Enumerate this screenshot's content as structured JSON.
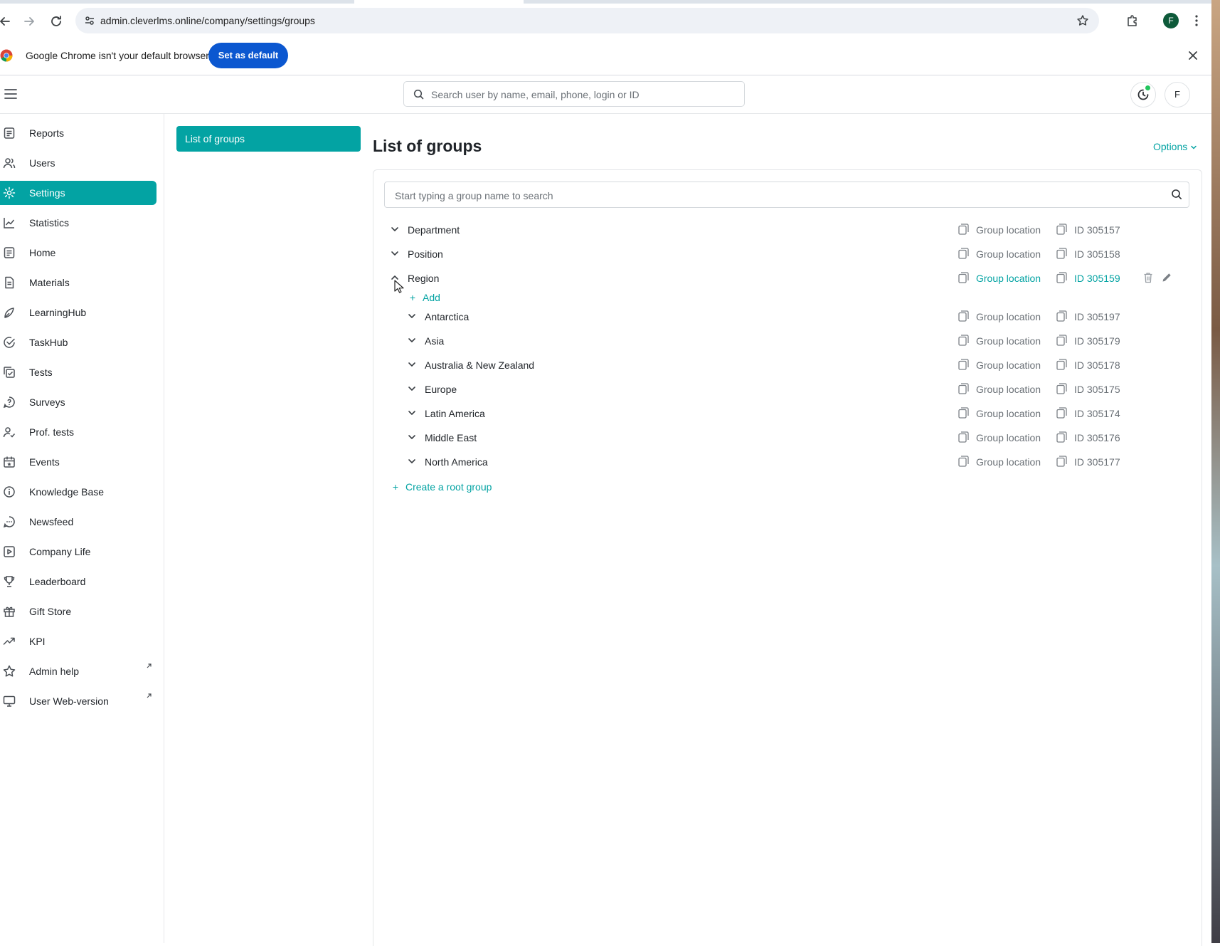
{
  "browser": {
    "url": "admin.cleverlms.online/company/settings/groups",
    "profile_initial": "F",
    "infobar_text": "Google Chrome isn't your default browser",
    "infobar_button": "Set as default"
  },
  "header": {
    "search_placeholder": "Search user by name, email, phone, login or ID",
    "avatar_initial": "F"
  },
  "sidebar": {
    "items": [
      {
        "label": "Reports",
        "icon": "reports-icon",
        "active": false
      },
      {
        "label": "Users",
        "icon": "users-icon",
        "active": false
      },
      {
        "label": "Settings",
        "icon": "settings-icon",
        "active": true
      },
      {
        "label": "Statistics",
        "icon": "statistics-icon",
        "active": false
      },
      {
        "label": "Home",
        "icon": "home-icon",
        "active": false
      },
      {
        "label": "Materials",
        "icon": "materials-icon",
        "active": false
      },
      {
        "label": "LearningHub",
        "icon": "learninghub-icon",
        "active": false
      },
      {
        "label": "TaskHub",
        "icon": "taskhub-icon",
        "active": false
      },
      {
        "label": "Tests",
        "icon": "tests-icon",
        "active": false
      },
      {
        "label": "Surveys",
        "icon": "surveys-icon",
        "active": false
      },
      {
        "label": "Prof. tests",
        "icon": "prof-tests-icon",
        "active": false
      },
      {
        "label": "Events",
        "icon": "events-icon",
        "active": false
      },
      {
        "label": "Knowledge Base",
        "icon": "knowledge-base-icon",
        "active": false
      },
      {
        "label": "Newsfeed",
        "icon": "newsfeed-icon",
        "active": false
      },
      {
        "label": "Company Life",
        "icon": "company-life-icon",
        "active": false
      },
      {
        "label": "Leaderboard",
        "icon": "leaderboard-icon",
        "active": false
      },
      {
        "label": "Gift Store",
        "icon": "gift-store-icon",
        "active": false
      },
      {
        "label": "KPI",
        "icon": "kpi-icon",
        "active": false
      },
      {
        "label": "Admin help",
        "icon": "admin-help-icon",
        "active": false,
        "external": true
      },
      {
        "label": "User Web-version",
        "icon": "user-web-version-icon",
        "active": false,
        "external": true
      }
    ]
  },
  "subnav": {
    "items": [
      {
        "label": "List of groups",
        "active": true
      }
    ]
  },
  "main": {
    "title": "List of groups",
    "options_label": "Options",
    "search_placeholder": "Start typing a group name to search",
    "groups": [
      {
        "name": "Department",
        "location": "Group location",
        "id": "ID 305157",
        "expanded": false
      },
      {
        "name": "Position",
        "location": "Group location",
        "id": "ID 305158",
        "expanded": false
      },
      {
        "name": "Region",
        "location": "Group location",
        "id": "ID 305159",
        "expanded": true,
        "hovered": true
      }
    ],
    "add_label": "Add",
    "children": [
      {
        "name": "Antarctica",
        "location": "Group location",
        "id": "ID 305197"
      },
      {
        "name": "Asia",
        "location": "Group location",
        "id": "ID 305179"
      },
      {
        "name": "Australia & New Zealand",
        "location": "Group location",
        "id": "ID 305178"
      },
      {
        "name": "Europe",
        "location": "Group location",
        "id": "ID 305175"
      },
      {
        "name": "Latin America",
        "location": "Group location",
        "id": "ID 305174"
      },
      {
        "name": "Middle East",
        "location": "Group location",
        "id": "ID 305176"
      },
      {
        "name": "North America",
        "location": "Group location",
        "id": "ID 305177"
      }
    ],
    "create_root_label": "Create a root group"
  },
  "colors": {
    "accent": "#03a3a3",
    "chrome_button": "#0b57d0"
  }
}
